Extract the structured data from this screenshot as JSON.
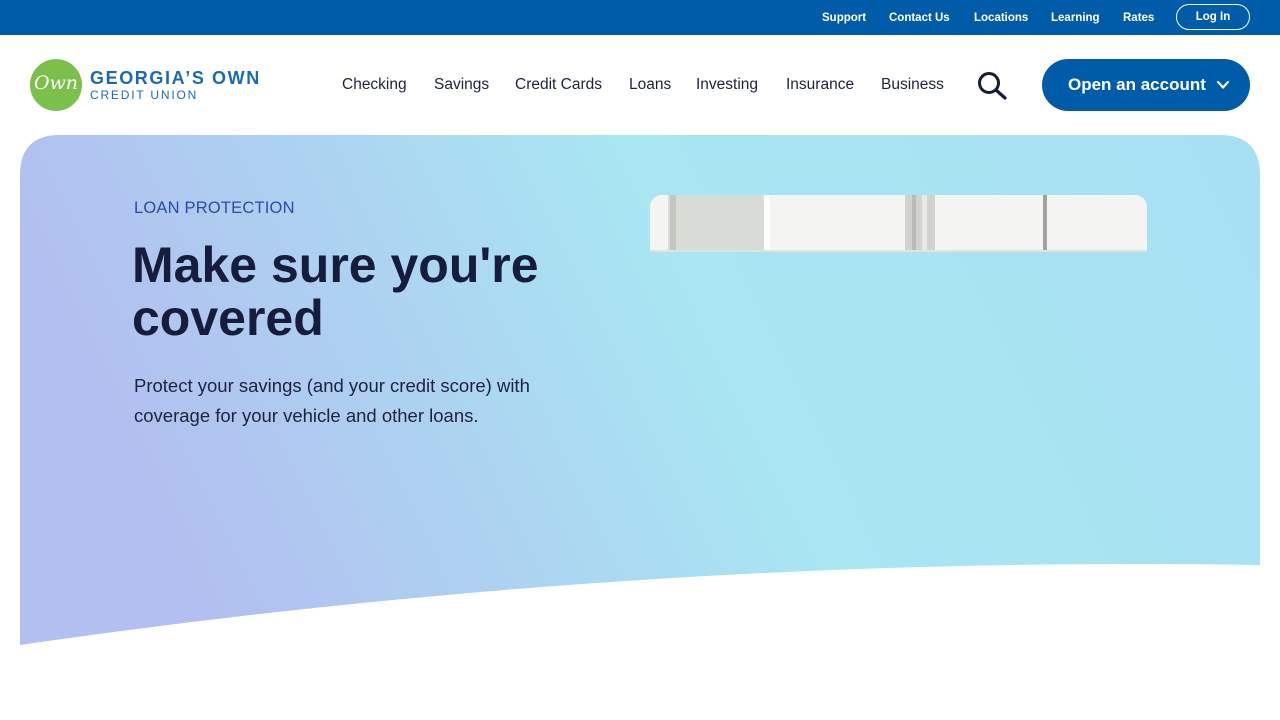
{
  "utility": {
    "links": [
      "Support",
      "Contact Us",
      "Locations",
      "Learning",
      "Rates"
    ],
    "login_label": "Log In"
  },
  "logo": {
    "mark": "Own",
    "name": "GEORGIA’S OWN",
    "sub": "CREDIT UNION"
  },
  "nav": {
    "items": [
      "Checking",
      "Savings",
      "Credit Cards",
      "Loans",
      "Investing",
      "Insurance",
      "Business"
    ],
    "search_icon": "search-icon",
    "cta_label": "Open an account",
    "cta_icon": "chevron-down-icon"
  },
  "hero": {
    "eyebrow": "LOAN PROTECTION",
    "headline": "Make sure you're covered",
    "body": "Protect your savings (and your credit score) with coverage for your vehicle and other loans."
  },
  "colors": {
    "utility_bar": "#005ca8",
    "brand_blue": "#005ca8",
    "logo_green": "#7cc04b",
    "headline": "#161c3c",
    "eyebrow": "#2a4ab0",
    "hero_gradient_start": "#b2bff0",
    "hero_gradient_end": "#a8e6f2"
  }
}
